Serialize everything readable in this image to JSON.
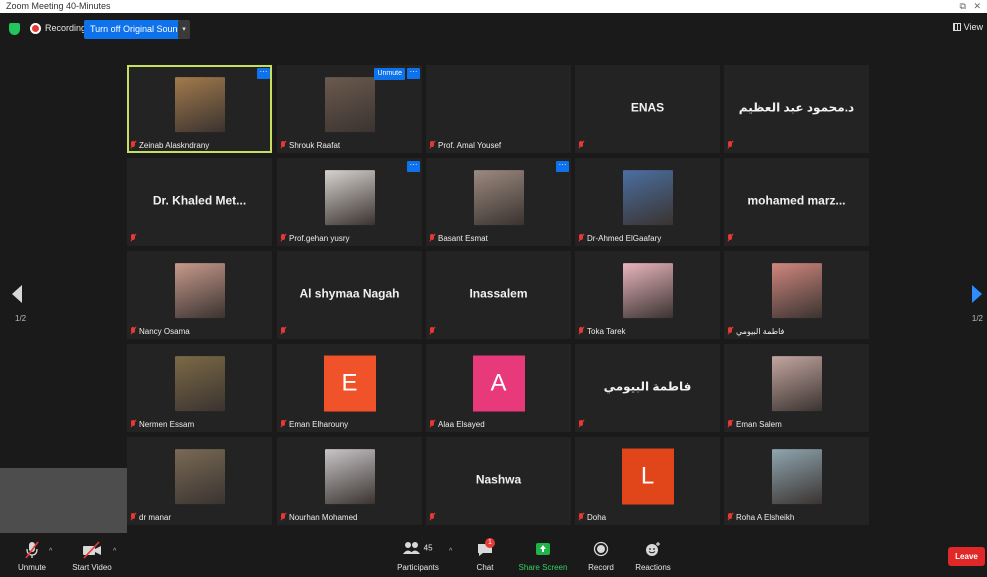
{
  "window": {
    "title": "Zoom Meeting 40-Minutes"
  },
  "topbar": {
    "recording_label": "Recording",
    "original_sound_button": "Turn off Original Sound",
    "view_label": "View"
  },
  "pager": {
    "left": "1/2",
    "right": "1/2"
  },
  "tiles": [
    {
      "label": "Zeinab Alaskndrany",
      "kind": "photo",
      "color": "#a37a4c",
      "active": true,
      "more": true
    },
    {
      "label": "Shrouk Raafat",
      "kind": "photo",
      "color": "#6b5a4e",
      "more": true,
      "unmute": "Unmute"
    },
    {
      "label": "Prof. Amal Yousef",
      "kind": "empty"
    },
    {
      "label": "",
      "kind": "name",
      "name": "ENAS"
    },
    {
      "label": "",
      "kind": "name",
      "name": "د.محمود عبد العظيم"
    },
    {
      "label": "",
      "kind": "name",
      "name": "Dr. Khaled Met..."
    },
    {
      "label": "Prof.gehan yusry",
      "kind": "photo",
      "color": "#d8d3cf",
      "more": true
    },
    {
      "label": "Basant Esmat",
      "kind": "photo",
      "color": "#9c8a7f",
      "more": true
    },
    {
      "label": "Dr-Ahmed ElGaafary",
      "kind": "photo",
      "color": "#4b6fa1"
    },
    {
      "label": "",
      "kind": "name",
      "name": "mohamed marz..."
    },
    {
      "label": "Nancy Osama",
      "kind": "photo",
      "color": "#c89a8c"
    },
    {
      "label": "",
      "kind": "name",
      "name": "Al shymaa Nagah"
    },
    {
      "label": "",
      "kind": "name",
      "name": "Inassalem"
    },
    {
      "label": "Toka Tarek",
      "kind": "photo",
      "color": "#e9b5bd"
    },
    {
      "label": "فاطمة البيومي",
      "kind": "photo",
      "color": "#d0877e"
    },
    {
      "label": "Nermen Essam",
      "kind": "photo",
      "color": "#7c6a46"
    },
    {
      "label": "Eman Elharouny",
      "kind": "letter",
      "letter": "E",
      "color": "#f0532a"
    },
    {
      "label": "Alaa Elsayed",
      "kind": "letter",
      "letter": "A",
      "color": "#e83a7a"
    },
    {
      "label": "",
      "kind": "name",
      "name": "فاطمة البيومي"
    },
    {
      "label": "Eman Salem",
      "kind": "photo",
      "color": "#c4a6a0"
    },
    {
      "label": "dr manar",
      "kind": "photo",
      "color": "#7a6a55"
    },
    {
      "label": "Nourhan Mohamed",
      "kind": "photo",
      "color": "#c9c6c8"
    },
    {
      "label": "",
      "kind": "name",
      "name": "Nashwa"
    },
    {
      "label": "Doha",
      "kind": "letter",
      "letter": "L",
      "color": "#e0461a"
    },
    {
      "label": "Roha A Elsheikh",
      "kind": "photo",
      "color": "#8fa6b0"
    }
  ],
  "toolbar": {
    "unmute": "Unmute",
    "start_video": "Start Video",
    "participants": "Participants",
    "participants_count": "45",
    "chat": "Chat",
    "chat_badge": "1",
    "share_screen": "Share Screen",
    "record": "Record",
    "reactions": "Reactions",
    "leave": "Leave"
  }
}
